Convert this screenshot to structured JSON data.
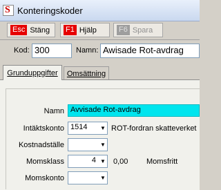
{
  "window": {
    "title": "Konteringskoder",
    "app_icon": "S"
  },
  "toolbar": {
    "close_key": "Esc",
    "close_label": "Stäng",
    "help_key": "F1",
    "help_label": "Hjälp",
    "save_key": "F6",
    "save_label": "Spara"
  },
  "header": {
    "kod_label": "Kod:",
    "kod_value": "300",
    "namn_label": "Namn:",
    "namn_value": "Awisade Rot-avdrag"
  },
  "tabs": [
    {
      "label": "Grunduppgifter",
      "active": true
    },
    {
      "label": "Omsättning",
      "active": false
    }
  ],
  "form": {
    "namn_label": "Namn",
    "namn_value": "Avvisade Rot-avdrag",
    "intaktskonto_label": "Intäktskonto",
    "intaktskonto_value": "1514",
    "intaktskonto_desc": "ROT-fordran skatteverket",
    "kostnadstalle_label": "Kostnadställe",
    "kostnadstalle_value": "",
    "momsklass_label": "Momsklass",
    "momsklass_value": "4",
    "momsklass_rate": "0,00",
    "momsklass_desc": "Momsfritt",
    "momskonto_label": "Momskonto",
    "momskonto_value": ""
  },
  "colors": {
    "highlight_field": "#00e5ee",
    "key_active": "#e60000",
    "key_disabled": "#9e9e9e"
  }
}
